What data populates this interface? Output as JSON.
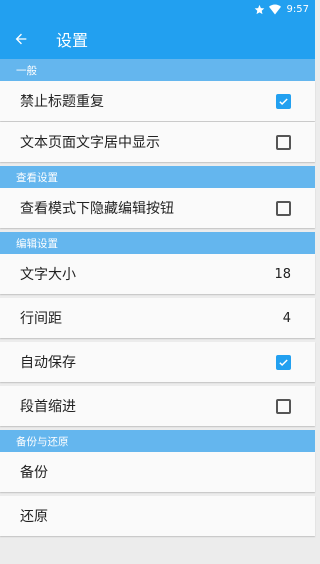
{
  "status_bar": {
    "time": "9:57",
    "icons": [
      "star-icon",
      "wifi-icon"
    ]
  },
  "app_bar": {
    "back_icon": "arrow-left-icon",
    "title": "设置"
  },
  "colors": {
    "primary": "#22a0f0",
    "section_header": "#64b6ee",
    "background": "#ececec",
    "item_background": "#fafafa"
  },
  "sections": [
    {
      "header": "一般",
      "items": [
        {
          "label": "禁止标题重复",
          "type": "checkbox",
          "checked": true
        },
        {
          "label": "文本页面文字居中显示",
          "type": "checkbox",
          "checked": false
        }
      ]
    },
    {
      "header": "查看设置",
      "items": [
        {
          "label": "查看模式下隐藏编辑按钮",
          "type": "checkbox",
          "checked": false
        }
      ]
    },
    {
      "header": "编辑设置",
      "items": [
        {
          "label": "文字大小",
          "type": "value",
          "value": "18"
        },
        {
          "label": "行间距",
          "type": "value",
          "value": "4"
        },
        {
          "label": "自动保存",
          "type": "checkbox",
          "checked": true
        },
        {
          "label": "段首缩进",
          "type": "checkbox",
          "checked": false
        }
      ]
    },
    {
      "header": "备份与还原",
      "items": [
        {
          "label": "备份",
          "type": "action"
        },
        {
          "label": "还原",
          "type": "action"
        }
      ]
    }
  ]
}
